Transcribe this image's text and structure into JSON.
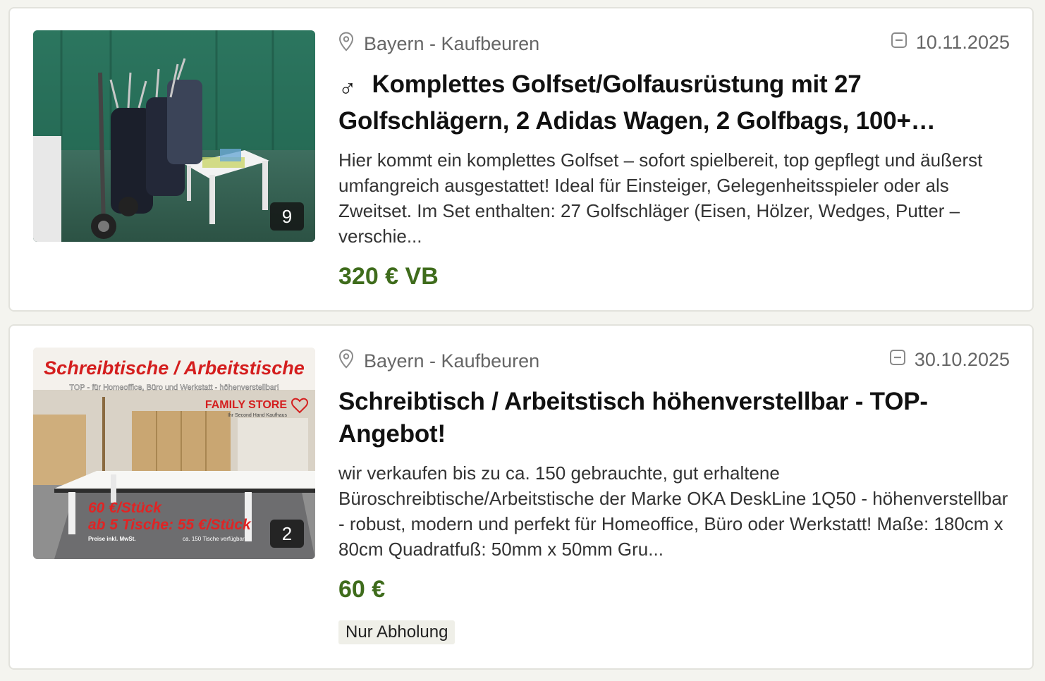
{
  "listings": [
    {
      "location": "Bayern - Kaufbeuren",
      "date": "10.11.2025",
      "title_icon": "♂",
      "title": "Komplettes Golfset/Golfausrüstung mit 27 Golfschlägern, 2 Adidas Wagen, 2 Golfbags, 100+…",
      "description": "Hier kommt ein komplettes Golfset – sofort spielbereit, top gepflegt und äußerst umfangreich ausgestattet! Ideal für Einsteiger, Gelegenheitsspieler oder als Zweitset. Im Set enthalten: 27 Golfschläger (Eisen, Hölzer, Wedges, Putter – verschie...",
      "price": "320 € VB",
      "image_count": "9"
    },
    {
      "location": "Bayern - Kaufbeuren",
      "date": "30.10.2025",
      "title": "Schreibtisch / Arbeitstisch höhenverstellbar - TOP-Angebot!",
      "description": "wir verkaufen bis zu ca. 150 gebrauchte, gut erhaltene Büroschreibtische/Arbeitstische der Marke OKA DeskLine 1Q50 - höhenverstellbar - robust, modern und perfekt für Homeoffice, Büro oder Werkstatt! Maße: 180cm x 80cm Quadratfuß: 50mm x 50mm Gru...",
      "price": "60 €",
      "tag": "Nur Abholung",
      "image_count": "2",
      "image_text": {
        "headline": "Schreibtische / Arbeitstische",
        "subline": "TOP - für Homeoffice, Büro und Werkstatt - höhenverstellbar!",
        "brand": "FAMILY STORE",
        "brand_sub": "Ihr Second Hand Kaufhaus",
        "price_line_1": "60 €/Stück",
        "price_line_2": "ab 5 Tische: 55 €/Stück",
        "footnote_left": "Preise inkl. MwSt.",
        "footnote_right": "ca. 150 Tische verfügbar"
      }
    }
  ],
  "colors": {
    "price": "#3f6c1c",
    "background": "#f4f4ef",
    "card": "#ffffff"
  }
}
